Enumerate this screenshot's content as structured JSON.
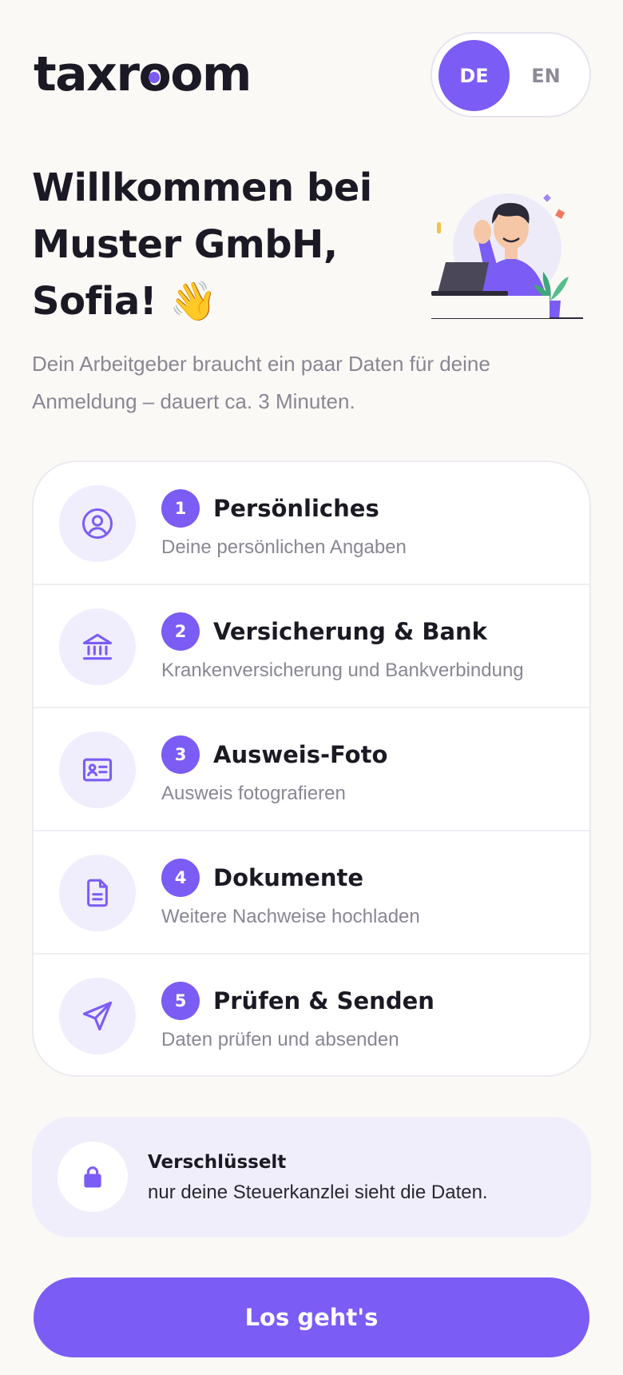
{
  "header": {
    "logo": {
      "before": "taxr",
      "o_dot": "o",
      "after": "om"
    },
    "language": {
      "active": "DE",
      "inactive": "EN"
    }
  },
  "hero": {
    "title_line1": "Willkommen bei",
    "title_line2": "Muster GmbH,",
    "title_line3": "Sofia! 👋",
    "subtitle": "Dein Arbeitgeber braucht ein paar Daten für deine Anmeldung – dauert ca. 3 Minuten."
  },
  "steps": [
    {
      "number": "1",
      "title": "Persönliches",
      "description": "Deine persönlichen Angaben",
      "icon": "user-circle-icon"
    },
    {
      "number": "2",
      "title": "Versicherung & Bank",
      "description": "Krankenversicherung und Bankverbindung",
      "icon": "bank-icon"
    },
    {
      "number": "3",
      "title": "Ausweis-Foto",
      "description": "Ausweis fotografieren",
      "icon": "id-card-icon"
    },
    {
      "number": "4",
      "title": "Dokumente",
      "description": "Weitere Nachweise hochladen",
      "icon": "document-icon"
    },
    {
      "number": "5",
      "title": "Prüfen & Senden",
      "description": "Daten prüfen und absenden",
      "icon": "send-icon"
    }
  ],
  "security": {
    "title": "Verschlüsselt",
    "text": "nur deine Steuerkanzlei sieht die Daten.",
    "icon": "lock-icon"
  },
  "cta": {
    "label": "Los geht's"
  },
  "colors": {
    "accent": "#7B5CF5",
    "accent_light": "#F0EDFC",
    "background": "#FBF9F6",
    "text": "#1B1923",
    "muted": "#8A8693"
  }
}
